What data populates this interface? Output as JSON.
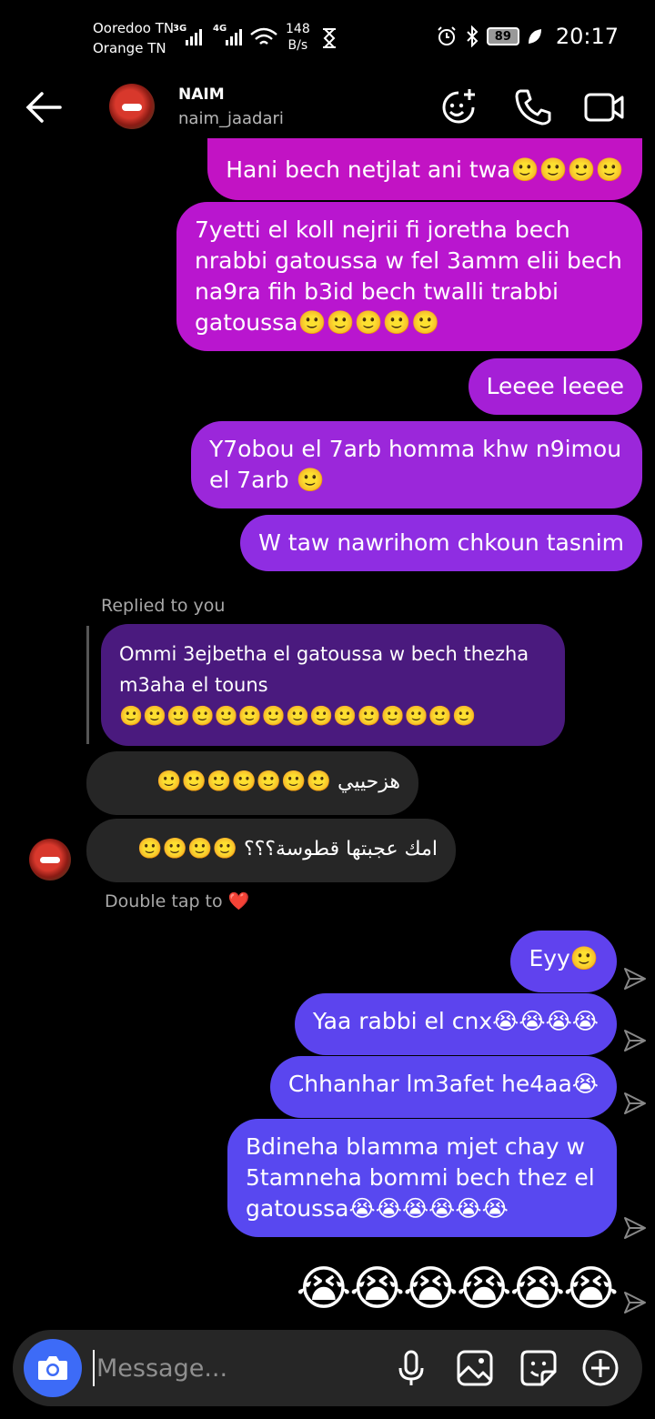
{
  "status_bar": {
    "carrier1": "Ooredoo TN",
    "carrier2": "Orange TN",
    "net1": "3G",
    "net2": "4G",
    "speed_value": "148",
    "speed_unit": "B/s",
    "battery": "89",
    "time": "20:17",
    "icons": [
      "alarm-icon",
      "bluetooth-icon",
      "battery-icon",
      "leaf-icon"
    ]
  },
  "header": {
    "name": "NAIM",
    "username": "naim_jaadari",
    "icons": [
      "back-arrow-icon",
      "add-effect-icon",
      "phone-icon",
      "video-icon"
    ]
  },
  "messages": [
    {
      "text": "Hani bech netjlat ani twa",
      "emoji": "🙂🙂🙂🙂"
    },
    {
      "text": "7yetti el koll nejrii fi joretha bech nrabbi gatoussa w fel 3amm elii bech na9ra fih b3id bech twalli trabbi gatoussa",
      "emoji": "🙂🙂🙂🙂🙂"
    },
    {
      "text": "Leeee leeee",
      "emoji": ""
    },
    {
      "text": "Y7obou el 7arb homma khw n9imou el 7arb ",
      "emoji": "🙂"
    },
    {
      "text": "W taw nawrihom chkoun tasnim",
      "emoji": ""
    },
    {
      "text": "Ommi 3ejbetha el gatoussa w bech thezha m3aha el touns",
      "emoji": "🙂🙂🙂🙂🙂🙂🙂🙂🙂🙂🙂🙂🙂🙂🙂"
    },
    {
      "text": "هزحييي",
      "emoji": "🙂🙂🙂🙂🙂🙂🙂"
    },
    {
      "text": "امك عجبتها قطوسة؟؟؟",
      "emoji": "🙂🙂🙂🙂"
    },
    {
      "text": "Eyy",
      "emoji": "🙂"
    },
    {
      "text": "Yaa rabbi el cnx",
      "emoji": "😭😭😭😭"
    },
    {
      "text": "Chhanhar lm3afet he4aa",
      "emoji": "😭"
    },
    {
      "text": "Bdineha blamma mjet chay w 5tamneha bommi bech thez el gatoussa",
      "emoji": "😭😭😭😭😭😭"
    },
    {
      "text": "",
      "emoji": "😭😭😭😭😭😭"
    }
  ],
  "reply_label": "Replied to you",
  "double_tap": "Double tap to",
  "heart": "❤️",
  "composer": {
    "placeholder": "Message...",
    "icons": [
      "camera-icon",
      "microphone-icon",
      "gallery-icon",
      "sticker-icon",
      "plus-circle-icon"
    ]
  },
  "colors": {
    "bubble_magenta": "#c213c4",
    "bubble_purple_top": "#a51fd6",
    "bubble_purple": "#7c33ea",
    "bubble_blue": "#5d45ee",
    "received": "#262626",
    "replied": "#4a1a7e",
    "camera": "#3d6bf7"
  }
}
